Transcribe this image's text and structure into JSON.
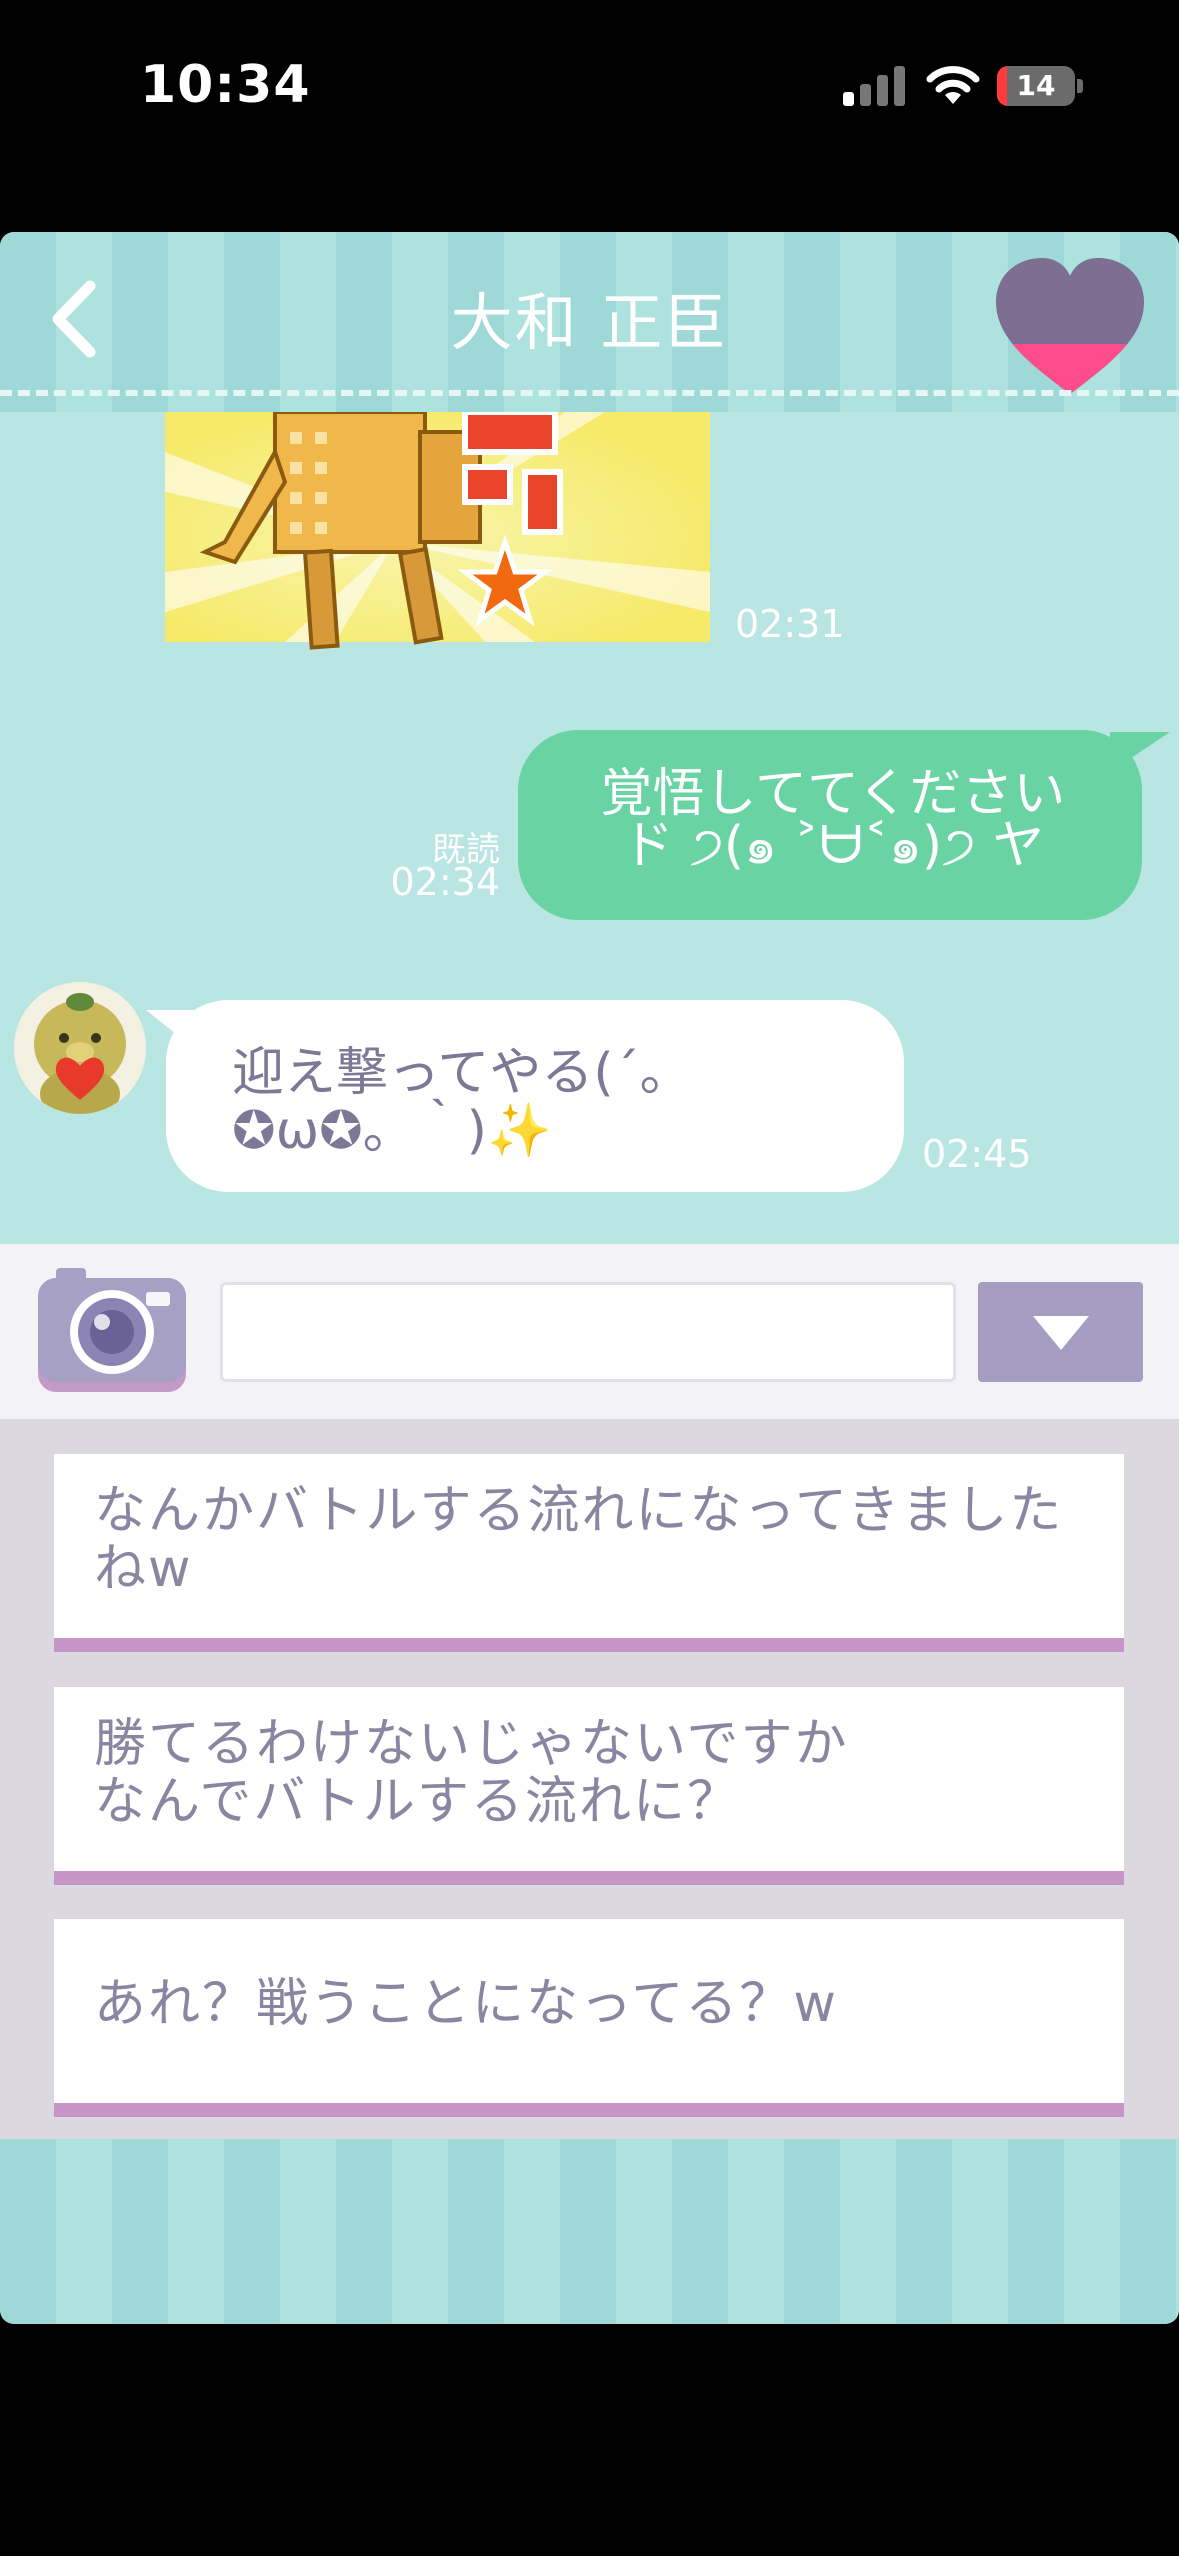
{
  "status_bar": {
    "time": "10:34",
    "battery": "14",
    "icons": [
      "cellular-signal-icon",
      "wifi-icon",
      "battery-icon"
    ]
  },
  "header": {
    "title": "大和 正臣",
    "back_icon": "chevron-left-icon",
    "favorite_icon": "heart-icon"
  },
  "chat": {
    "messages": [
      {
        "sender": "them",
        "type": "sticker",
        "time": "02:31"
      },
      {
        "sender": "me",
        "type": "text",
        "text": "覚悟しててください\nド ੭(๑ ˃ᗨ˂๑)੭ ヤ",
        "read_label": "既読",
        "time": "02:34"
      },
      {
        "sender": "them",
        "type": "text",
        "text": "迎え撃ってやる(´。\n✪ω✪。｀)✨",
        "time": "02:45"
      }
    ]
  },
  "input_bar": {
    "camera_icon": "camera-icon",
    "text_value": "",
    "dropdown_icon": "triangle-down-icon"
  },
  "choices": [
    {
      "text": "なんかバトルする流れになってきました\nねw"
    },
    {
      "text": "勝てるわけないじゃないですか\nなんでバトルする流れに？"
    },
    {
      "text": "あれ？戦うことになってる？w"
    }
  ],
  "colors": {
    "header_stripe_a": "#9ed9d7",
    "header_stripe_b": "#aee2de",
    "chat_background": "#b9e6e2",
    "my_bubble": "#69d3a4",
    "their_bubble": "#ffffff",
    "their_text": "#7d7895",
    "accent_purple": "#a59ec2",
    "choice_border": "#c694c6",
    "heart_pink": "#ff4d8c"
  }
}
